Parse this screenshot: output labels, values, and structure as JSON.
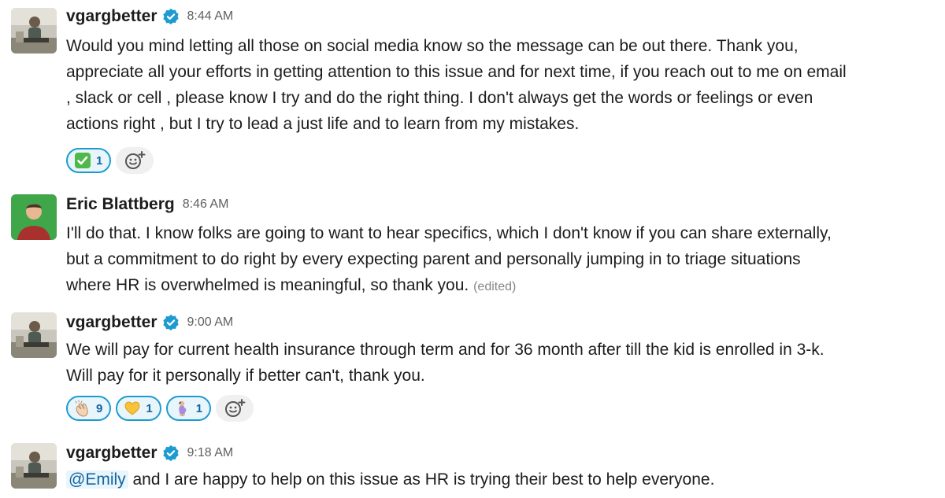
{
  "messages": [
    {
      "author": "vgargbetter",
      "verified": true,
      "time": "8:44 AM",
      "lines": [
        "Would you mind letting all those on social media know so the message can be out there. Thank you,",
        "appreciate all your efforts in getting attention to this issue and for next time, if you reach out to me on email",
        ", slack or cell , please know I try and do the right thing. I don't always get the words or feelings or even",
        "actions right , but I try to lead a just life and to learn from my mistakes."
      ],
      "reactions": [
        {
          "emoji": "white-check-mark-icon",
          "count": "1"
        }
      ]
    },
    {
      "author": "Eric Blattberg",
      "verified": false,
      "time": "8:46 AM",
      "lines": [
        "I'll do that. I know folks are going to want to hear specifics, which I don't know if you can share externally,",
        "but a commitment to do right by every expecting parent and personally jumping in to triage situations",
        "where HR is overwhelmed is meaningful, so thank you."
      ],
      "edited_label": "(edited)"
    },
    {
      "author": "vgargbetter",
      "verified": true,
      "time": "9:00 AM",
      "lines": [
        "We will pay for current health insurance through term and for 36 month after till the kid is enrolled in 3-k.",
        "Will pay for it personally if better can't, thank you."
      ],
      "reactions": [
        {
          "emoji": "clapping-hands-icon",
          "count": "9"
        },
        {
          "emoji": "yellow-heart-icon",
          "count": "1"
        },
        {
          "emoji": "pregnant-person-icon",
          "count": "1"
        }
      ]
    },
    {
      "author": "vgargbetter",
      "verified": true,
      "time": "9:18 AM",
      "mention": "@Emily",
      "text_after_mention": " and I are happy to help on this issue as HR is trying their best to help everyone."
    }
  ],
  "colors": {
    "link": "#1264a3",
    "reaction_border": "#1d9bd1",
    "reaction_bg": "#e8f5fa",
    "verified": "#1d9bd1",
    "timestamp": "#616061"
  },
  "add_reaction_icon": "add-reaction-icon"
}
